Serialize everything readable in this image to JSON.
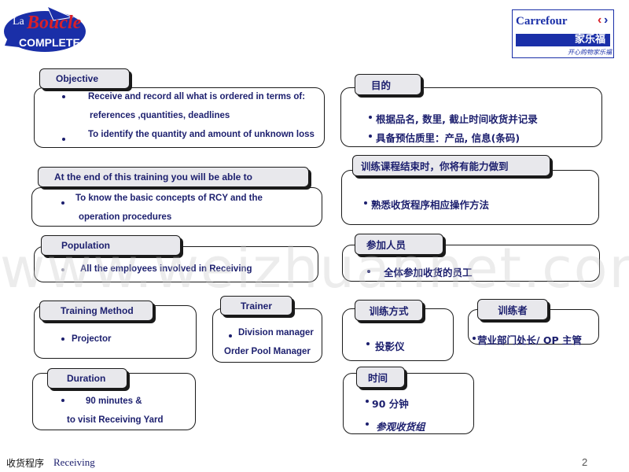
{
  "header": {
    "left_logo": {
      "line1": "La",
      "line2": "Boucle",
      "line3": "COMPLETE"
    },
    "right_logo": {
      "brand": "Carrefour",
      "chinese": "家乐福",
      "slogan": "开心购物家乐福"
    }
  },
  "sections_en": {
    "objective": {
      "title": "Objective",
      "items": [
        "Receive and record all what is ordered in terms of:",
        "references ,quantities, deadlines",
        "To identify the quantity and amount of  unknown loss"
      ]
    },
    "outcome": {
      "title": "At the end of this training you will be able to",
      "items": [
        "To know  the basic concepts of RCY and the",
        "operation procedures"
      ]
    },
    "population": {
      "title": "Population",
      "items": [
        "All the employees involved in Receiving"
      ]
    },
    "method": {
      "title": "Training Method",
      "items": [
        "Projector"
      ]
    },
    "trainer": {
      "title": "Trainer",
      "items": [
        "Division manager",
        "Order Pool  Manager"
      ]
    },
    "duration": {
      "title": "Duration",
      "items": [
        "90 minutes &",
        "to  visit Receiving Yard"
      ]
    }
  },
  "sections_cn": {
    "objective": {
      "title": "目的",
      "items": [
        "根据品名, 数里, 截止时间收货并记录",
        "具备预估质里：产品, 信息(条码)"
      ]
    },
    "outcome": {
      "title": "训练课程结束时，你将有能力做到",
      "items": [
        "熟悉收货程序相应操作方法"
      ]
    },
    "population": {
      "title": "参加人员",
      "items": [
        "全体参加收货的员工"
      ]
    },
    "method": {
      "title": "训练方式",
      "items": [
        "投影仪"
      ]
    },
    "trainer": {
      "title": "训练者",
      "items": [
        "营业部门处长/ OP 主管"
      ]
    },
    "duration": {
      "title": "时间",
      "items": [
        "90 分钟",
        "参观收货组"
      ]
    }
  },
  "footer": {
    "label_cn": "收货程序",
    "label_en": "Receiving",
    "page_number": "2"
  },
  "watermark": "www.weizhuannet.com",
  "colors": {
    "text": "#1c1f6e",
    "tab_bg": "#e8e8ec",
    "logo_blue": "#1a2fa8",
    "logo_red": "#d8202a"
  }
}
